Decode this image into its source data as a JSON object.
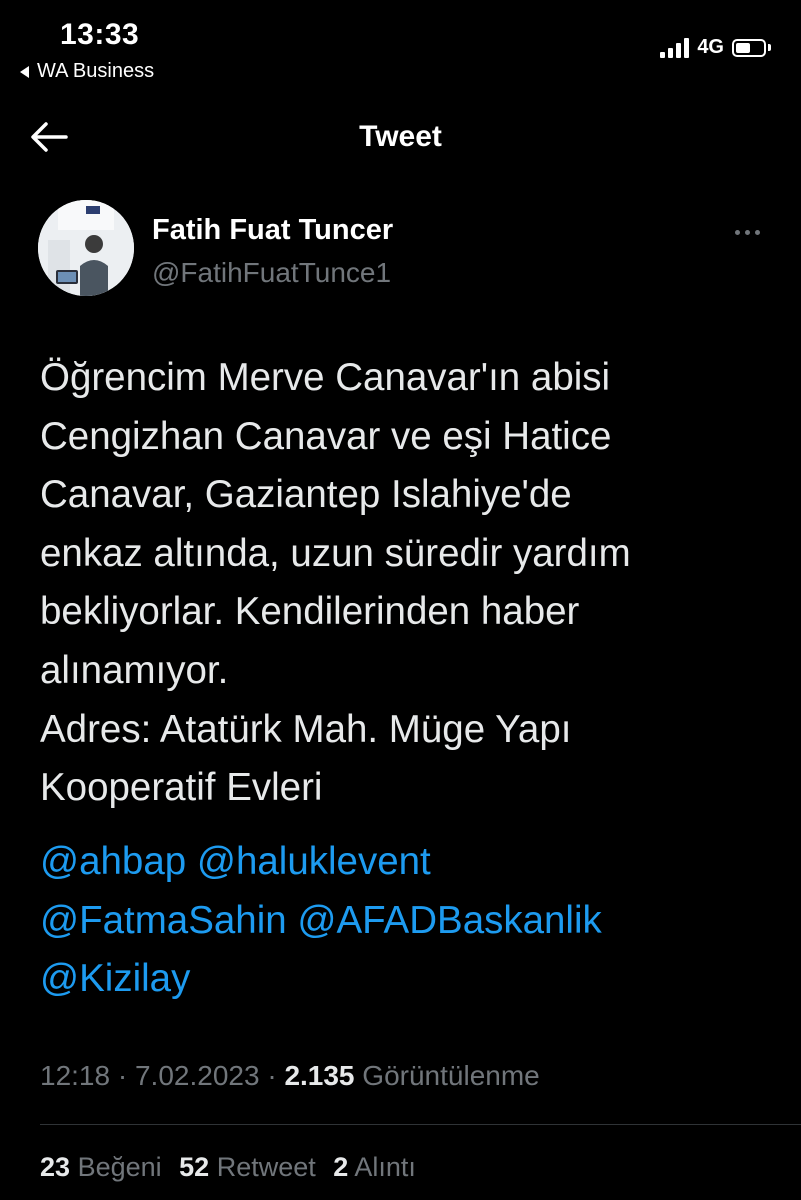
{
  "status_bar": {
    "time": "13:33",
    "back_app": "WA Business",
    "network": "4G",
    "battery_level": 0.55
  },
  "nav": {
    "title": "Tweet"
  },
  "author": {
    "name": "Fatih Fuat Tuncer",
    "handle": "@FatihFuatTunce1"
  },
  "tweet": {
    "text": "Öğrencim Merve Canavar'ın abisi\nCengizhan Canavar ve eşi Hatice\nCanavar, Gaziantep Islahiye'de\nenkaz altında, uzun süredir yardım\nbekliyorlar. Kendilerinden haber\nalınamıyor.\nAdres: Atatürk Mah. Müge Yapı\nKooperatif Evleri",
    "mentions": [
      "@ahbap",
      "@haluklevent",
      "@FatmaSahin",
      "@AFADBaskanlik",
      "@Kizilay"
    ]
  },
  "meta": {
    "time": "12:18",
    "date": "7.02.2023",
    "views": "2.135",
    "views_label": "Görüntülenme",
    "separator": "·"
  },
  "stats": {
    "likes": "23",
    "likes_label": "Beğeni",
    "retweets": "52",
    "retweets_label": "Retweet",
    "quotes": "2",
    "quotes_label": "Alıntı"
  },
  "colors": {
    "background": "#000000",
    "link": "#1d9bf0",
    "secondary": "#71767b",
    "divider": "#2f3336"
  },
  "icons": [
    "back-arrow-icon",
    "more-icon",
    "signal-icon",
    "battery-icon"
  ]
}
